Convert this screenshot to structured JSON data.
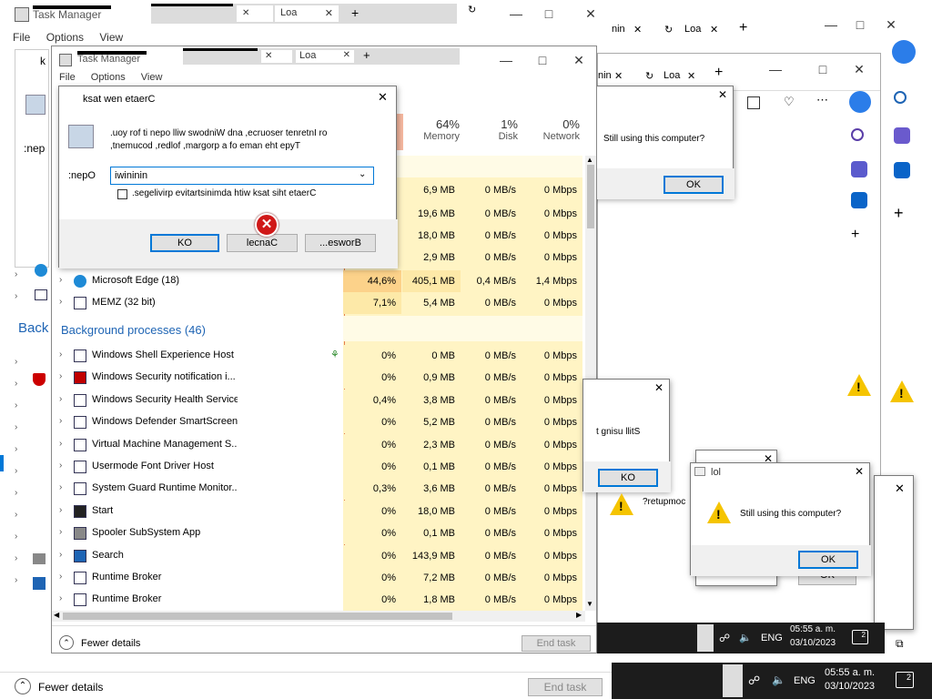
{
  "back_tm": {
    "title": "Task Manager",
    "menu": [
      "File",
      "Options",
      "View"
    ],
    "tab_label": "Loa",
    "k_label": "k",
    "nep_label": ":nep",
    "back_label": "Back",
    "fewer_details": "Fewer details",
    "end_task": "End task"
  },
  "mid_browser": {
    "tab_min": "nin",
    "tab_load": "Loa"
  },
  "edge_browser": {
    "tab_min": "nin",
    "tab_load": "Loa"
  },
  "tm": {
    "title": "Task Manager",
    "menu": [
      "File",
      "Options",
      "View"
    ],
    "tab_label": "Loa",
    "columns": [
      {
        "pct": "64%",
        "label": "Memory"
      },
      {
        "pct": "1%",
        "label": "Disk"
      },
      {
        "pct": "0%",
        "label": "Network"
      }
    ],
    "app_rows_top": [
      {
        "mem": "6,9 MB",
        "disk": "0 MB/s",
        "net": "0 Mbps"
      },
      {
        "mem": "19,6 MB",
        "disk": "0 MB/s",
        "net": "0 Mbps"
      },
      {
        "mem": "18,0 MB",
        "disk": "0 MB/s",
        "net": "0 Mbps"
      },
      {
        "mem": "2,9 MB",
        "disk": "0 MB/s",
        "net": "0 Mbps"
      }
    ],
    "apps": [
      {
        "name": "Microsoft Edge (18)",
        "cpu": "44,6%",
        "mem": "405,1 MB",
        "disk": "0,4 MB/s",
        "net": "1,4 Mbps"
      },
      {
        "name": "MEMZ (32 bit)",
        "cpu": "7,1%",
        "mem": "5,4 MB",
        "disk": "0 MB/s",
        "net": "0 Mbps"
      }
    ],
    "bg_header": "Background processes (46)",
    "processes": [
      {
        "name": "Windows Shell Experience Host",
        "cpu": "0%",
        "mem": "0 MB",
        "disk": "0 MB/s",
        "net": "0 Mbps"
      },
      {
        "name": "Windows Security notification i...",
        "cpu": "0%",
        "mem": "0,9 MB",
        "disk": "0 MB/s",
        "net": "0 Mbps"
      },
      {
        "name": "Windows Security Health Service",
        "cpu": "0,4%",
        "mem": "3,8 MB",
        "disk": "0 MB/s",
        "net": "0 Mbps"
      },
      {
        "name": "Windows Defender SmartScreen",
        "cpu": "0%",
        "mem": "5,2 MB",
        "disk": "0 MB/s",
        "net": "0 Mbps"
      },
      {
        "name": "Virtual Machine Management S...",
        "cpu": "0%",
        "mem": "2,3 MB",
        "disk": "0 MB/s",
        "net": "0 Mbps"
      },
      {
        "name": "Usermode Font Driver Host",
        "cpu": "0%",
        "mem": "0,1 MB",
        "disk": "0 MB/s",
        "net": "0 Mbps"
      },
      {
        "name": "System Guard Runtime Monitor...",
        "cpu": "0,3%",
        "mem": "3,6 MB",
        "disk": "0 MB/s",
        "net": "0 Mbps"
      },
      {
        "name": "Start",
        "cpu": "0%",
        "mem": "18,0 MB",
        "disk": "0 MB/s",
        "net": "0 Mbps"
      },
      {
        "name": "Spooler SubSystem App",
        "cpu": "0%",
        "mem": "0,1 MB",
        "disk": "0 MB/s",
        "net": "0 Mbps"
      },
      {
        "name": "Search",
        "cpu": "0%",
        "mem": "143,9 MB",
        "disk": "0 MB/s",
        "net": "0 Mbps"
      },
      {
        "name": "Runtime Broker",
        "cpu": "0%",
        "mem": "7,2 MB",
        "disk": "0 MB/s",
        "net": "0 Mbps"
      },
      {
        "name": "Runtime Broker",
        "cpu": "0%",
        "mem": "1,8 MB",
        "disk": "0 MB/s",
        "net": "0 Mbps"
      }
    ],
    "fewer_details": "Fewer details",
    "end_task": "End task"
  },
  "run_dialog": {
    "title": "ksat wen etaerC",
    "desc_line1": ".uoy rof ti nepo lliw swodniW dna ,ecruoser tenretnI ro",
    "desc_line2": ",tnemucod ,redlof ,margorp a fo eman eht epyT",
    "open_label": ":nepO",
    "open_value": "iwininin",
    "checkbox_label": ".segelivirp evitartsinimda htiw ksat siht etaerC",
    "ok": "KO",
    "cancel": "lecnaC",
    "browse": "...esworB"
  },
  "still_dialog_1": {
    "message": "Still using this computer?",
    "ok": "OK"
  },
  "still_dialog_2": {
    "message": "t gnisu llitS",
    "ok": "KO",
    "msg2": "?retupmoc"
  },
  "still_dialog_3": {
    "title": "lol",
    "message": "Still using this computer?",
    "ok": "OK",
    "ok2": "OK"
  },
  "taskbar_back": {
    "lang": "ENG",
    "time": "05:55 a. m.",
    "date": "03/10/2023",
    "notif": "2"
  },
  "taskbar_front": {
    "lang": "ENG",
    "time": "05:55 a. m.",
    "date": "03/10/2023",
    "notif": "2"
  },
  "colors": {
    "accent": "#0078d7",
    "heat": "#fff4c4",
    "heat_strong": "#fde9a8",
    "group_header": "#1e64b4"
  }
}
